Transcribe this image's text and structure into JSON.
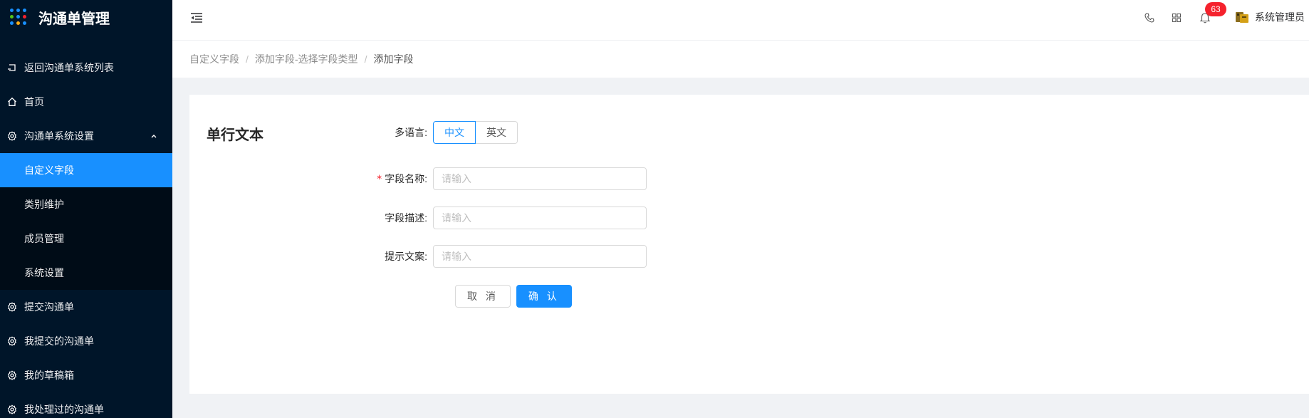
{
  "app": {
    "title": "沟通单管理"
  },
  "colors": {
    "sidebar_bg": "#001529",
    "submenu_bg": "#000c17",
    "accent": "#1890ff",
    "badge": "#f5222d",
    "logo_dots": [
      "#1890ff",
      "#1890ff",
      "#1890ff",
      "#52c41a",
      "#1890ff",
      "#f5222d",
      "#1890ff",
      "#faad14",
      "#1890ff"
    ]
  },
  "sidebar": {
    "items": [
      {
        "label": "返回沟通单系统列表",
        "icon": "return-icon"
      },
      {
        "label": "首页",
        "icon": "home-icon"
      },
      {
        "label": "沟通单系统设置",
        "icon": "gear-icon",
        "expanded": true,
        "children": [
          {
            "label": "自定义字段",
            "active": true
          },
          {
            "label": "类别维护"
          },
          {
            "label": "成员管理"
          },
          {
            "label": "系统设置"
          }
        ]
      },
      {
        "label": "提交沟通单",
        "icon": "gear-icon"
      },
      {
        "label": "我提交的沟通单",
        "icon": "gear-icon"
      },
      {
        "label": "我的草稿箱",
        "icon": "gear-icon"
      },
      {
        "label": "我处理过的沟通单",
        "icon": "gear-icon"
      }
    ]
  },
  "header": {
    "notification_count": "63",
    "user_name": "系统管理员"
  },
  "breadcrumb": [
    "自定义字段",
    "添加字段-选择字段类型",
    "添加字段"
  ],
  "form": {
    "title": "单行文本",
    "language": {
      "label": "多语言:",
      "options": [
        "中文",
        "英文"
      ],
      "selected": "中文"
    },
    "field_name": {
      "label": "字段名称:",
      "required": true,
      "placeholder": "请输入",
      "value": ""
    },
    "field_desc": {
      "label": "字段描述:",
      "placeholder": "请输入",
      "value": ""
    },
    "hint_text": {
      "label": "提示文案:",
      "placeholder": "请输入",
      "value": ""
    },
    "cancel_label": "取 消",
    "confirm_label": "确 认"
  }
}
